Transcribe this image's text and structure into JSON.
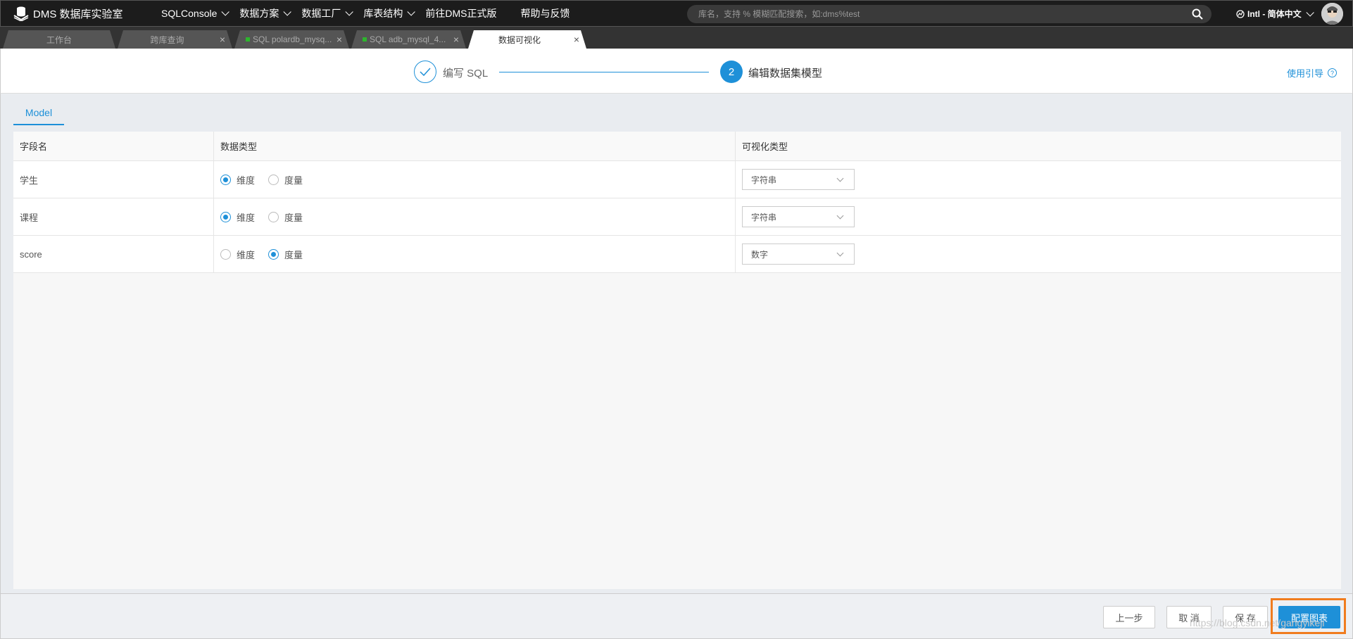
{
  "app": {
    "title": "DMS 数据库实验室"
  },
  "nav": {
    "items": [
      {
        "label": "SQLConsole",
        "dropdown": true
      },
      {
        "label": "数据方案",
        "dropdown": true
      },
      {
        "label": "数据工厂",
        "dropdown": true
      },
      {
        "label": "库表结构",
        "dropdown": true
      },
      {
        "label": "前往DMS正式版",
        "dropdown": false
      },
      {
        "label": "帮助与反馈",
        "dropdown": false
      }
    ]
  },
  "search": {
    "placeholder": "库名，支持 % 模糊匹配搜索，如:dms%test",
    "value": ""
  },
  "lang": {
    "label": "Intl - 简体中文"
  },
  "tabs": [
    {
      "label": "工作台",
      "closable": false,
      "active": false
    },
    {
      "label": "跨库查询",
      "closable": true,
      "active": false
    },
    {
      "label": "SQL polardb_mysq...",
      "closable": true,
      "active": false,
      "status": "connected"
    },
    {
      "label": "SQL adb_mysql_4...",
      "closable": true,
      "active": false,
      "status": "connected"
    },
    {
      "label": "数据可视化",
      "closable": true,
      "active": true
    }
  ],
  "stepper": {
    "step1": {
      "number": "1",
      "label": "编写 SQL",
      "done": true
    },
    "step2": {
      "number": "2",
      "label": "编辑数据集模型",
      "current": true
    },
    "guide_label": "使用引导",
    "guide_icon": "?"
  },
  "model": {
    "tab_label": "Model",
    "columns": [
      "字段名",
      "数据类型",
      "可视化类型"
    ],
    "radio_labels": {
      "dimension": "维度",
      "measure": "度量"
    },
    "rows": [
      {
        "field": "学生",
        "data_type": "dimension",
        "vis_type": "字符串"
      },
      {
        "field": "课程",
        "data_type": "dimension",
        "vis_type": "字符串"
      },
      {
        "field": "score",
        "data_type": "measure",
        "vis_type": "数字"
      }
    ]
  },
  "footer": {
    "prev_label": "上一步",
    "cancel_label": "取 消",
    "save_label": "保 存",
    "config_label": "配置图表"
  },
  "watermark": "https://blog.csdn.net/gangyikeji",
  "colors": {
    "accent": "#1e90d8",
    "highlight": "#f07c1e",
    "topbar": "#1c1c1c",
    "tab_status": "#2db52d"
  }
}
